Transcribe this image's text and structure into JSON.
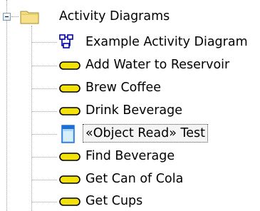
{
  "tree": {
    "root": {
      "label": "Activity Diagrams",
      "icon": "folder-icon",
      "expanded": true
    },
    "items": [
      {
        "label": "Example Activity Diagram",
        "icon": "activity-diagram-icon"
      },
      {
        "label": "Add Water to Reservoir",
        "icon": "activity-node-icon"
      },
      {
        "label": "Brew Coffee",
        "icon": "activity-node-icon"
      },
      {
        "label": "Drink Beverage",
        "icon": "activity-node-icon"
      },
      {
        "label": "«Object Read» Test",
        "icon": "object-node-icon",
        "selected": true
      },
      {
        "label": "Find Beverage",
        "icon": "activity-node-icon"
      },
      {
        "label": "Get Can of Cola",
        "icon": "activity-node-icon"
      },
      {
        "label": "Get Cups",
        "icon": "activity-node-icon"
      }
    ]
  },
  "colors": {
    "selection_outline": "#444444",
    "node_fill": "#f2e10a",
    "node_stroke": "#000000"
  }
}
